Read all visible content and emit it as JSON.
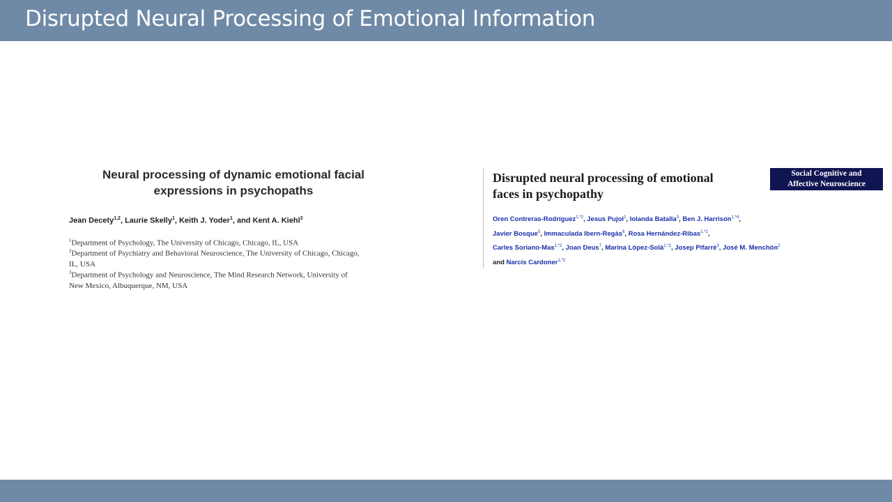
{
  "slide": {
    "title": "Disrupted Neural Processing of Emotional Information"
  },
  "left_paper": {
    "title_line1": "Neural processing of dynamic emotional facial",
    "title_line2": "expressions in psychopaths",
    "authors": [
      {
        "name": "Jean Decety",
        "sup": "1,2",
        "sep": ", "
      },
      {
        "name": "Laurie Skelly",
        "sup": "1",
        "sep": ", "
      },
      {
        "name": "Keith J. Yoder",
        "sup": "1",
        "sep": ", and "
      },
      {
        "name": "Kent A. Kiehl",
        "sup": "3",
        "sep": ""
      }
    ],
    "affiliations": [
      {
        "sup": "1",
        "line1": "Department of Psychology, The University of Chicago, Chicago, IL, USA",
        "line2": ""
      },
      {
        "sup": "2",
        "line1": "Department of Psychiatry and Behavioral Neuroscience, The University of Chicago, Chicago,",
        "line2": "IL, USA"
      },
      {
        "sup": "3",
        "line1": "Department of Psychology and Neuroscience, The Mind Research Network, University of",
        "line2": "New Mexico, Albuquerque, NM, USA"
      }
    ]
  },
  "right_paper": {
    "title_line1": "Disrupted neural processing of emotional",
    "title_line2": "faces in psychopathy",
    "journal_line1": "Social Cognitive and",
    "journal_line2": "Affective Neuroscience",
    "author_lines": [
      [
        {
          "name": "Oren Contreras-Rodríguez",
          "sup": "1,*2",
          "sep": ", "
        },
        {
          "name": "Jesus Pujol",
          "sup": "1",
          "sep": ", "
        },
        {
          "name": "Iolanda Batalla",
          "sup": "3",
          "sep": ", "
        },
        {
          "name": "Ben J. Harrison",
          "sup": "1,*4",
          "sep": ","
        }
      ],
      [
        {
          "name": "Javier Bosque",
          "sup": "5",
          "sep": ", "
        },
        {
          "name": "Immaculada Ibern-Regàs",
          "sup": "6",
          "sep": ", "
        },
        {
          "name": "Rosa Hernández-Ribas",
          "sup": "1,*2",
          "sep": ","
        }
      ],
      [
        {
          "name": "Carles Soriano-Mas",
          "sup": "1,*2",
          "sep": ", "
        },
        {
          "name": "Joan Deus",
          "sup": "7",
          "sep": ", "
        },
        {
          "name": "Marina López-Solà",
          "sup": "1,*2",
          "sep": ", "
        },
        {
          "name": "Josep Pifarré",
          "sup": "3",
          "sep": ", "
        },
        {
          "name": "José M. Menchón",
          "sup": "2",
          "sep": ""
        }
      ],
      [
        {
          "prefix": "and ",
          "name": "Narcís Cardoner",
          "sup": "1,*2",
          "sep": ""
        }
      ]
    ]
  }
}
